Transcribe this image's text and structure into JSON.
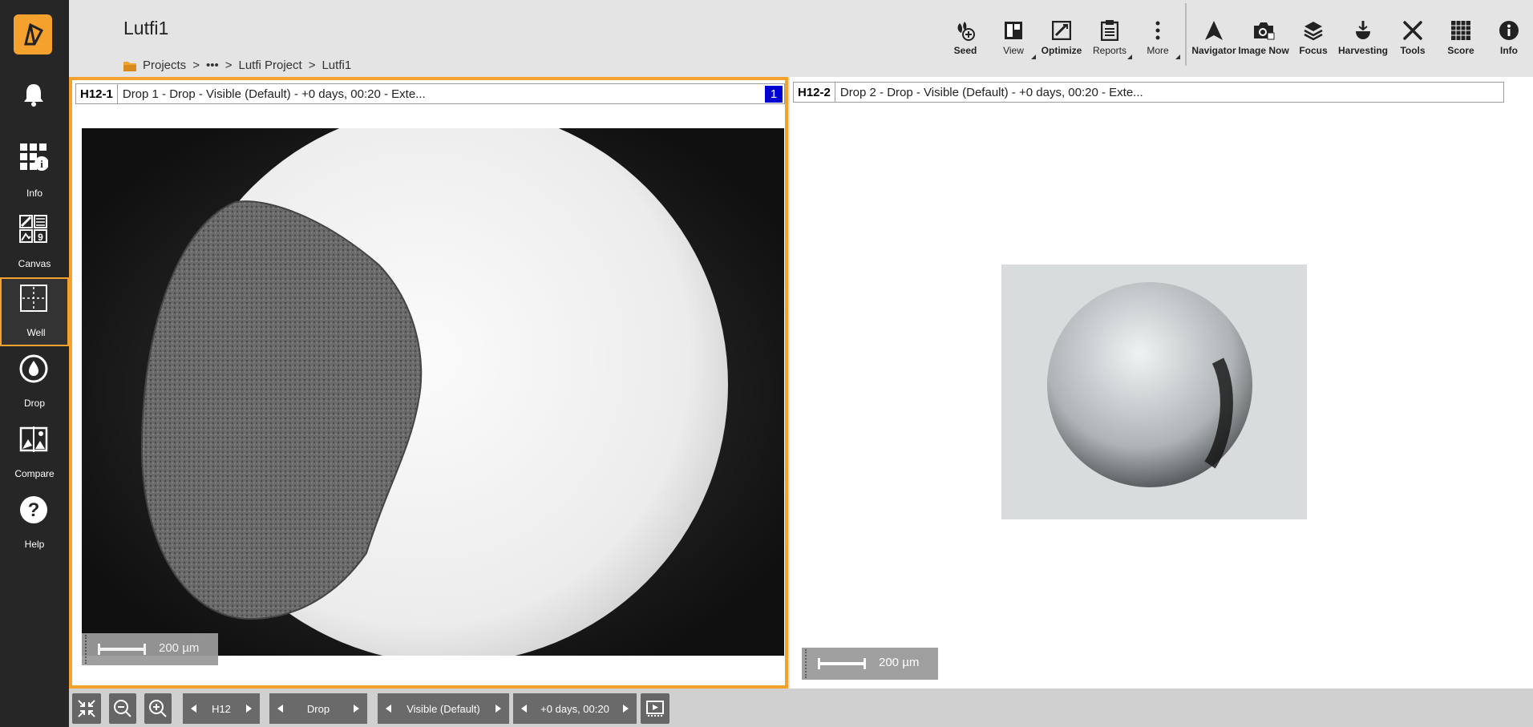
{
  "app": {
    "title": "Lutfi1"
  },
  "breadcrumb": {
    "items": [
      "Projects",
      "•••",
      "Lutfi Project",
      "Lutfi1"
    ],
    "sep": ">"
  },
  "sidebar": {
    "items": [
      {
        "label": "",
        "icon": "bell-icon"
      },
      {
        "label": "Info",
        "icon": "info-grid-icon"
      },
      {
        "label": "Canvas",
        "icon": "canvas-icon"
      },
      {
        "label": "Well",
        "icon": "well-icon",
        "active": true
      },
      {
        "label": "Drop",
        "icon": "drop-icon"
      },
      {
        "label": "Compare",
        "icon": "compare-icon"
      },
      {
        "label": "Help",
        "icon": "help-icon"
      }
    ]
  },
  "toolbar": {
    "seed": "Seed",
    "view": "View",
    "optimize": "Optimize",
    "reports": "Reports",
    "more": "More",
    "navigator": "Navigator",
    "image_now": "Image Now",
    "focus": "Focus",
    "harvesting": "Harvesting",
    "tools": "Tools",
    "score": "Score",
    "info": "Info"
  },
  "panels": [
    {
      "id": "H12-1",
      "desc": "Drop 1 - Drop - Visible (Default) - +0 days, 00:20 - Exte...",
      "badge": "1",
      "scale": "200 µm"
    },
    {
      "id": "H12-2",
      "desc": "Drop 2 - Drop - Visible (Default) - +0 days, 00:20 - Exte...",
      "scale": "200 µm"
    }
  ],
  "bottom": {
    "well": "H12",
    "drop": "Drop",
    "imaging": "Visible (Default)",
    "time": "+0 days, 00:20"
  },
  "colors": {
    "accent": "#f5a12d",
    "badge": "#0000d0",
    "sidebar": "#262626"
  }
}
